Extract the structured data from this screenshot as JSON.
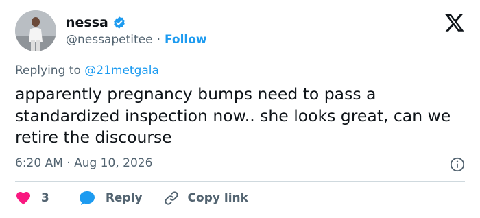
{
  "author": {
    "name": "nessa",
    "handle": "@nessapetitee",
    "follow_label": "Follow",
    "separator": "·"
  },
  "reply_context": {
    "prefix": "Replying to",
    "mention": "@21metgala"
  },
  "tweet": {
    "text": "apparently pregnancy bumps need to pass a standardized inspection now.. she looks great, can we retire the discourse",
    "timestamp": "6:20 AM · Aug 10, 2026"
  },
  "actions": {
    "like_count": "3",
    "reply_label": "Reply",
    "copy_link_label": "Copy link"
  },
  "icons": {
    "verified": "verified-badge-icon",
    "platform": "x-logo-icon",
    "info": "info-icon",
    "like": "heart-icon",
    "reply": "speech-bubble-icon",
    "copy": "link-icon"
  },
  "colors": {
    "accent": "#1d9bf0",
    "like": "#f91880",
    "text": "#0f1419",
    "secondary": "#536471"
  }
}
